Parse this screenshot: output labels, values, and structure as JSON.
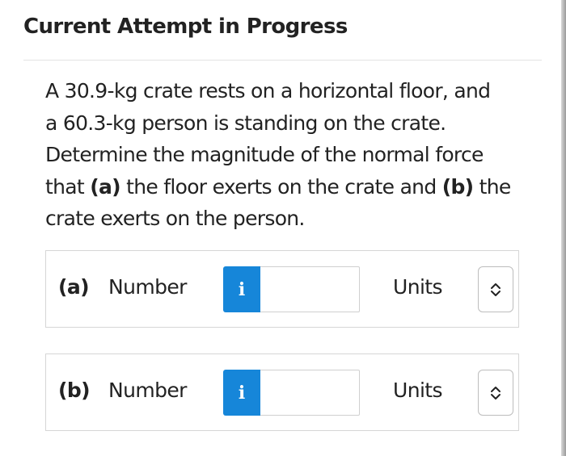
{
  "header": {
    "title": "Current Attempt in Progress"
  },
  "question": {
    "line1": "A 30.9-kg crate rests on a horizontal floor, and",
    "line2": "a 60.3-kg person is standing on the crate.",
    "line3": "Determine the magnitude of the normal force",
    "line4_pre": "that ",
    "line4_a": "(a)",
    "line4_mid": " the floor exerts on the crate and ",
    "line4_b": "(b)",
    "line4_post": " the",
    "line5": "crate exerts on the person."
  },
  "answers": [
    {
      "part": "(a)",
      "number_label": "Number",
      "info_glyph": "i",
      "input_value": "",
      "units_label": "Units",
      "icon": "chevron-up-down-icon"
    },
    {
      "part": "(b)",
      "number_label": "Number",
      "info_glyph": "i",
      "input_value": "",
      "units_label": "Units",
      "icon": "chevron-up-down-icon"
    }
  ],
  "colors": {
    "accent": "#1686d9",
    "text": "#222222",
    "border": "#d6d6d6"
  }
}
